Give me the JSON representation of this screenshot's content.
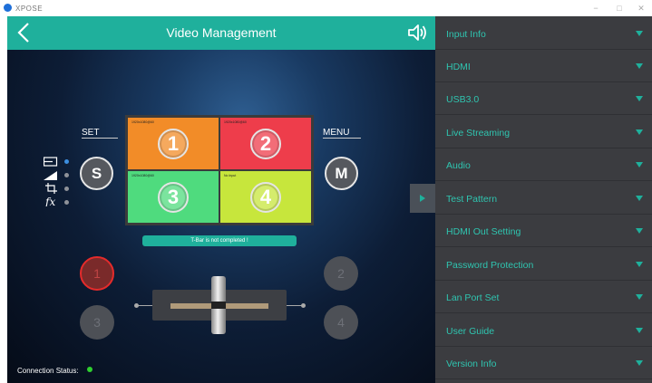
{
  "window": {
    "title": "XPOSE",
    "minimize": "−",
    "maximize": "□",
    "close": "✕"
  },
  "header": {
    "title": "Video Management"
  },
  "controls": {
    "set_label": "SET",
    "menu_label": "MENU",
    "s_button": "S",
    "m_button": "M"
  },
  "preview": {
    "cells": [
      {
        "label": "1920x1080@60",
        "number": "1",
        "color": "#f28c28"
      },
      {
        "label": "1920x1080@60",
        "number": "2",
        "color": "#ee3d4b"
      },
      {
        "label": "1920x1080@60",
        "number": "3",
        "color": "#4fdb7e"
      },
      {
        "label": "No Input",
        "number": "4",
        "color": "#c7e63c"
      }
    ]
  },
  "tbar": {
    "status": "T-Bar is not completed !"
  },
  "inputs": {
    "left": [
      "1",
      "3"
    ],
    "right": [
      "2",
      "4"
    ]
  },
  "status": {
    "connection_label": "Connection Status:",
    "connection_color": "#2fd02f"
  },
  "sidebar": {
    "items": [
      {
        "label": "Input Info"
      },
      {
        "label": "HDMI"
      },
      {
        "label": "USB3.0"
      },
      {
        "label": "Live Streaming"
      },
      {
        "label": "Audio"
      },
      {
        "label": "Test Pattern"
      },
      {
        "label": "HDMI Out Setting"
      },
      {
        "label": "Password Protection"
      },
      {
        "label": "Lan Port Set"
      },
      {
        "label": "User Guide"
      },
      {
        "label": "Version Info"
      }
    ]
  },
  "colors": {
    "accent": "#1fb09c",
    "sidebar_bg": "#3b3c40",
    "active_red": "#e52b2b"
  }
}
